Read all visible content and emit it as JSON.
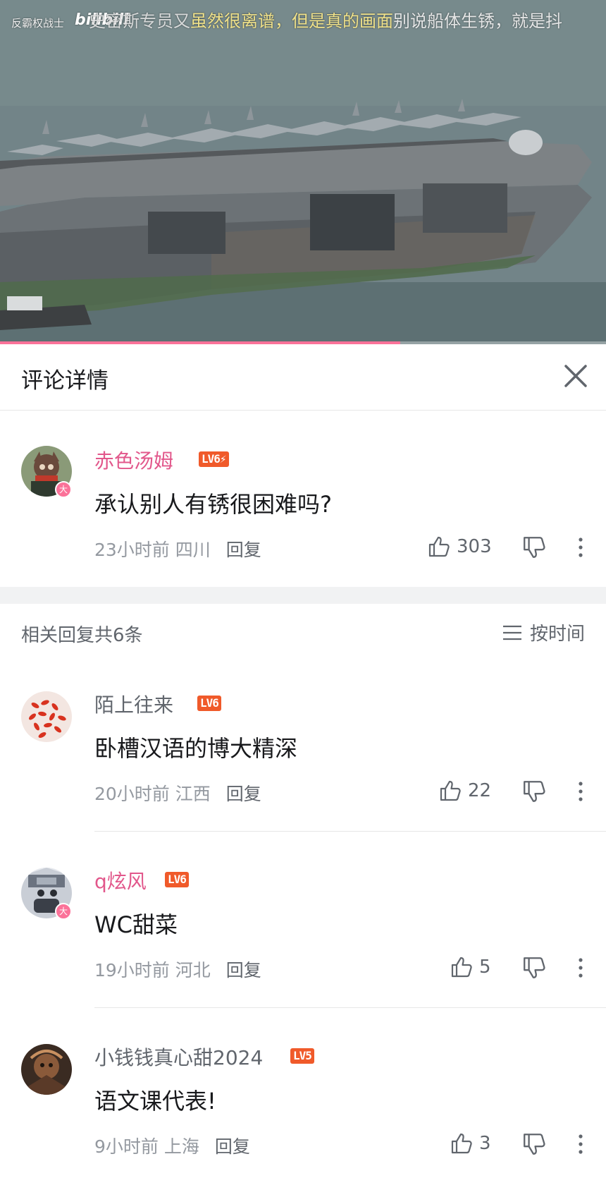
{
  "video": {
    "watermark_channel": "反霸权战士",
    "watermark_logo": "bilibili",
    "danmaku": [
      "史密斯专员又",
      "虽然很离谱，但是真的画面",
      "别说船体生锈，就是抖"
    ],
    "progress_fraction": 0.66
  },
  "panel": {
    "title": "评论详情",
    "close_icon": "close-icon"
  },
  "root_comment": {
    "username": "赤色汤姆",
    "level": "LV6⚡",
    "level_color": "#f05a2a",
    "content": "承认别人有锈很困难吗?",
    "time": "23小时前",
    "location": "四川",
    "reply_label": "回复",
    "likes": "303"
  },
  "replies_section": {
    "count_label": "相关回复共6条",
    "sort_label": "按时间"
  },
  "replies": [
    {
      "username": "陌上往来",
      "level": "LV6",
      "content": "卧槽汉语的博大精深",
      "time": "20小时前",
      "location": "江西",
      "reply_label": "回复",
      "likes": "22"
    },
    {
      "username": "q炫风",
      "level": "LV6",
      "content": "WC甜菜",
      "time": "19小时前",
      "location": "河北",
      "reply_label": "回复",
      "likes": "5"
    },
    {
      "username": "小钱钱真心甜2024",
      "level": "LV5",
      "content": "语文课代表!",
      "time": "9小时前",
      "location": "上海",
      "reply_label": "回复",
      "likes": "3"
    }
  ],
  "colors": {
    "accent_pink": "#fb7299",
    "level_orange": "#f05a2a"
  }
}
